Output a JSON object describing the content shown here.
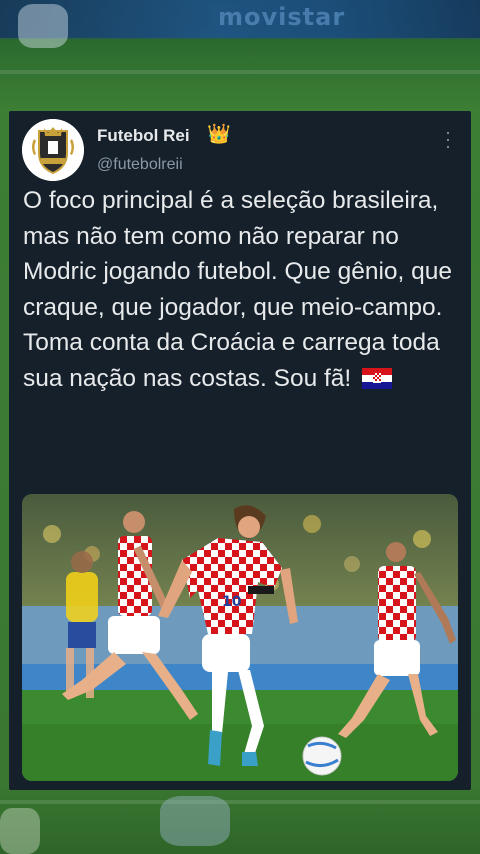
{
  "background": {
    "ad_text": "movistar"
  },
  "tweet": {
    "display_name": "Futebol Rei",
    "badge_emoji": "👑",
    "handle": "@futebolreii",
    "more_icon": "more-vertical-icon",
    "text": "O foco principal é a seleção brasileira, mas não tem como não reparar no Modric jogando futebol. Que gênio, que craque, que jogador, que meio-campo. Toma conta da Croácia e carrega toda sua nação nas costas. Sou fã!",
    "flag_emoji": "🇭🇷",
    "photo": {
      "description": "croatia-player-dribbling",
      "jersey_number": "10"
    }
  },
  "colors": {
    "card_bg": "#15202b",
    "primary_text": "#e7e9ea",
    "secondary_text": "#8b98a5",
    "croatia_red": "#d7141a",
    "brazil_yellow": "#f7d417"
  }
}
